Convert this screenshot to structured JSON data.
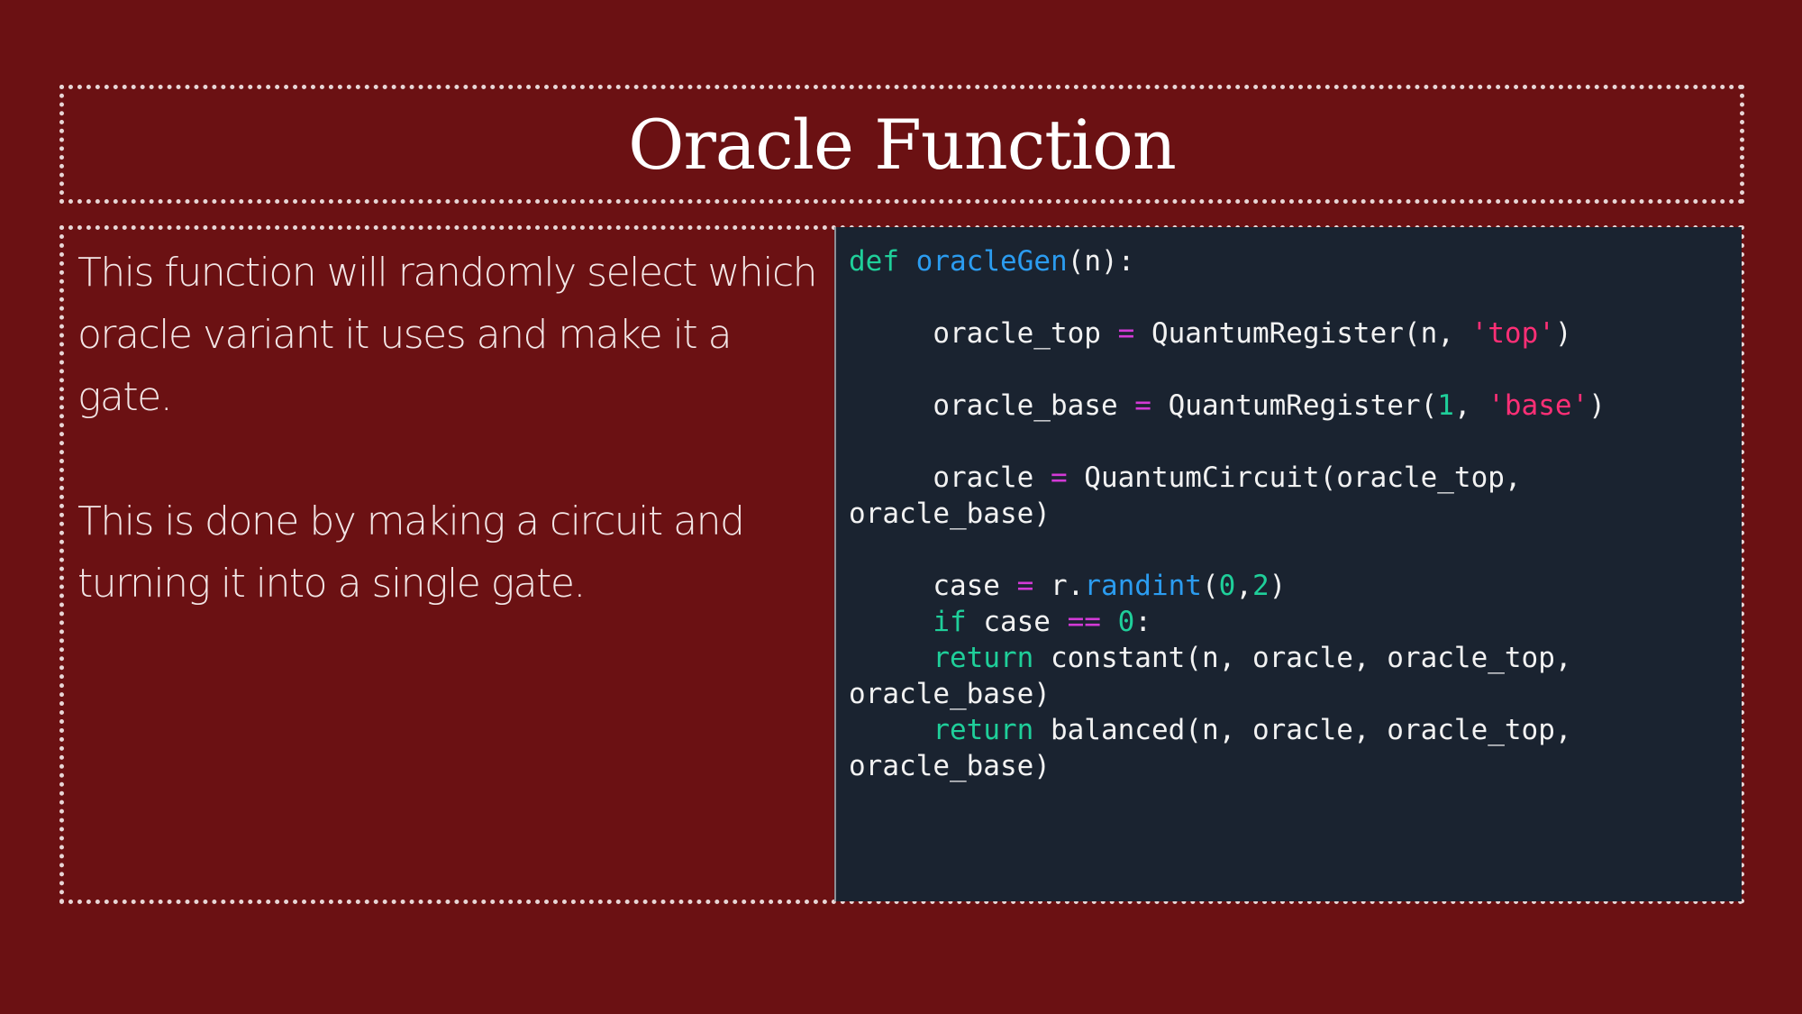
{
  "slide": {
    "title": "Oracle Function",
    "paragraphs": [
      "This function will randomly select which oracle variant it uses and make it a gate.",
      "This is done by making a circuit and turning it into a single gate."
    ]
  },
  "code": {
    "lines": [
      "def oracleGen(n):",
      "",
      "     oracle_top = QuantumRegister(n, 'top')",
      "",
      "     oracle_base = QuantumRegister(1, 'base')",
      "",
      "     oracle = QuantumCircuit(oracle_top,",
      "oracle_base)",
      "",
      "     case = r.randint(0,2)",
      "     if case == 0:",
      "     return constant(n, oracle, oracle_top,",
      "oracle_base)",
      "     return balanced(n, oracle, oracle_top,",
      "oracle_base)"
    ]
  },
  "colors": {
    "background": "#6b1113",
    "code_background": "#1a2330",
    "keyword": "#1fcf9a",
    "function": "#2b9cf0",
    "operator": "#d33ad6",
    "string": "#ff2f76",
    "number": "#1fcf9a"
  }
}
